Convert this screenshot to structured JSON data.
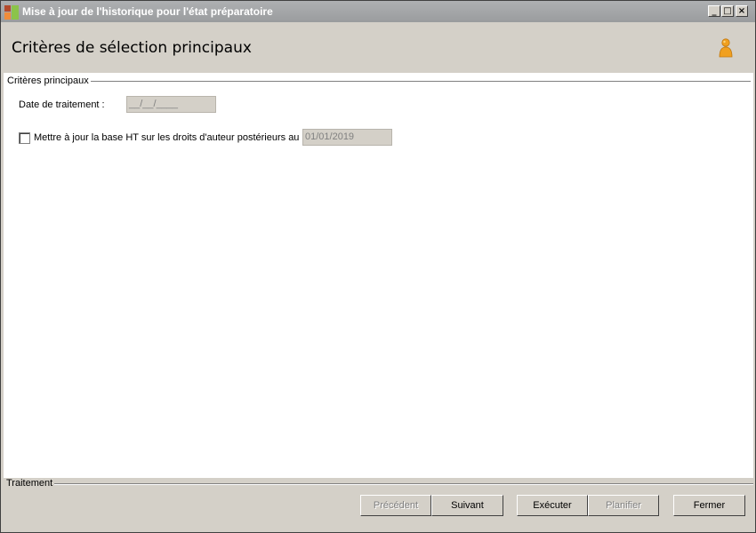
{
  "window": {
    "title": "Mise à jour de l'historique pour l'état préparatoire",
    "minimize": "_",
    "maximize": "□",
    "close": "×"
  },
  "header": {
    "title": "Critères de sélection principaux",
    "icon": "user-icon"
  },
  "criteria": {
    "group_label": "Critères principaux",
    "date_label": "Date de traitement :",
    "date_value": "__/__/____",
    "checkbox_label": "Mettre à jour la base HT sur les droits d'auteur postérieurs au :",
    "checkbox_checked": false,
    "post_date_value": "01/01/2019"
  },
  "footer": {
    "group_label": "Traitement",
    "buttons": {
      "previous": "Précédent",
      "next": "Suivant",
      "execute": "Exécuter",
      "schedule": "Planifier",
      "close": "Fermer"
    }
  },
  "colors": {
    "titlebar": "#9fa1a3",
    "background": "#d4d0c8",
    "content": "#ffffff",
    "accent_user_icon": "#f0a020"
  }
}
